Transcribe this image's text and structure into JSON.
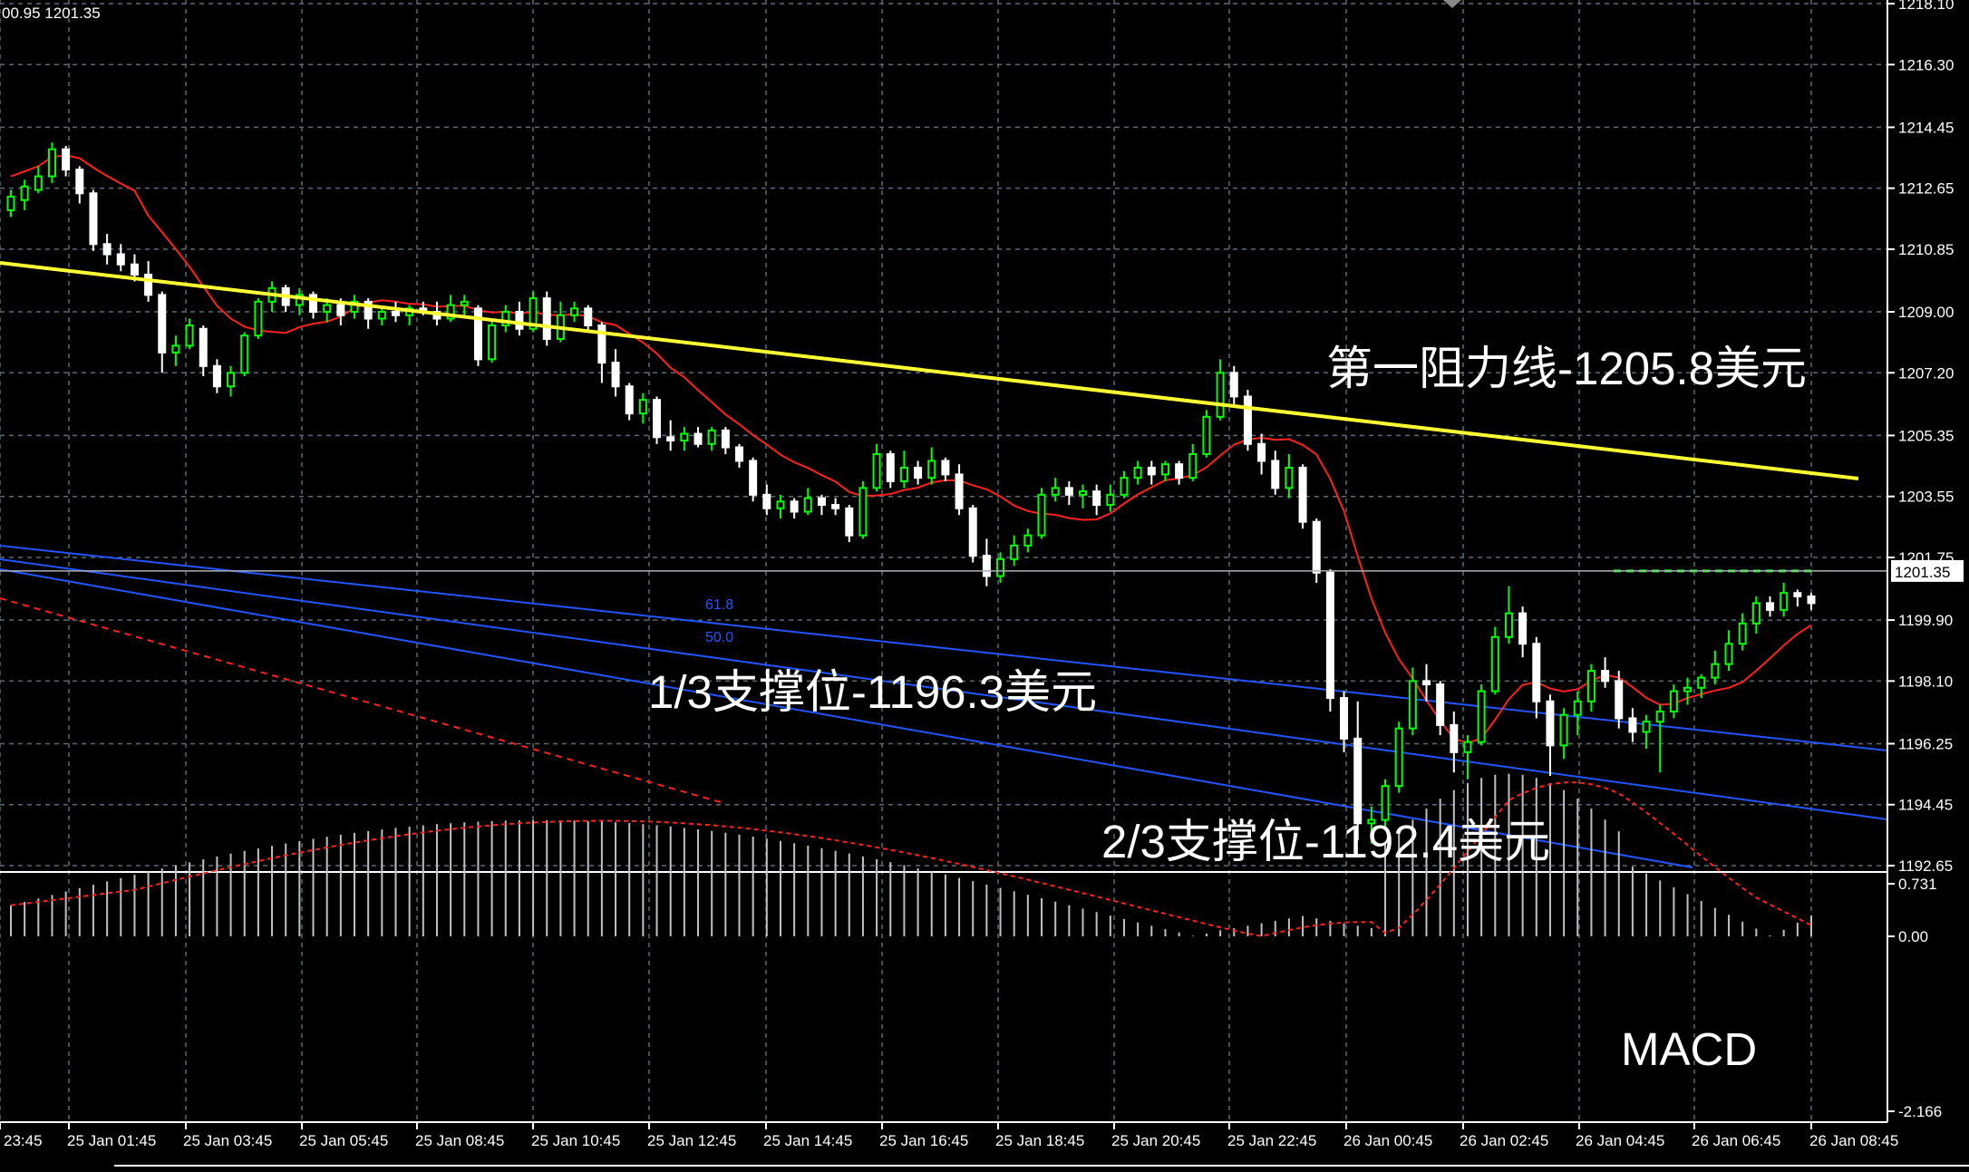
{
  "header": {
    "ohlc_text": "00.95 1201.35"
  },
  "price_axis": {
    "ticks": [
      "1218.10",
      "1216.30",
      "1214.45",
      "1212.65",
      "1210.85",
      "1209.00",
      "1207.20",
      "1205.35",
      "1203.55",
      "1201.75",
      "1199.90",
      "1198.10",
      "1196.25",
      "1194.45",
      "1192.65"
    ],
    "current_price": "1201.35"
  },
  "macd_axis": {
    "ticks": [
      "0.731",
      "0.00",
      "-2.166"
    ]
  },
  "time_axis": {
    "labels": [
      "23:45",
      "25 Jan 01:45",
      "25 Jan 03:45",
      "25 Jan 05:45",
      "25 Jan 08:45",
      "25 Jan 10:45",
      "25 Jan 12:45",
      "25 Jan 14:45",
      "25 Jan 16:45",
      "25 Jan 18:45",
      "25 Jan 20:45",
      "25 Jan 22:45",
      "26 Jan 00:45",
      "26 Jan 02:45",
      "26 Jan 04:45",
      "26 Jan 06:45",
      "26 Jan 08:45"
    ]
  },
  "annotations": {
    "resistance": "第一阻力线-1205.8美元",
    "support_1_3": "1/3支撑位-1196.3美元",
    "support_2_3": "2/3支撑位-1192.4美元",
    "macd_label": "MACD",
    "fib_61_8": "61.8",
    "fib_50_0": "50.0"
  },
  "colors": {
    "background": "#000000",
    "grid": "#5a6a74",
    "bull": "#00ff00",
    "bear": "#ffffff",
    "ma": "#ff2020",
    "trend": "#ffff33",
    "channel": "#2255ff",
    "macd_bar": "#c0c0c0",
    "signal": "#ff2020"
  },
  "chart_data": {
    "type": "candlestick",
    "timeframe": "15min",
    "ylim": [
      1192.65,
      1218.1
    ],
    "candles": [
      [
        1212.0,
        1212.6,
        1211.8,
        1212.4
      ],
      [
        1212.3,
        1212.9,
        1212.0,
        1212.7
      ],
      [
        1212.6,
        1213.3,
        1212.5,
        1213.0
      ],
      [
        1213.0,
        1214.0,
        1212.8,
        1213.8
      ],
      [
        1213.8,
        1213.9,
        1213.0,
        1213.2
      ],
      [
        1213.2,
        1213.3,
        1212.2,
        1212.5
      ],
      [
        1212.5,
        1212.6,
        1210.8,
        1211.0
      ],
      [
        1211.0,
        1211.3,
        1210.4,
        1210.7
      ],
      [
        1210.7,
        1211.0,
        1210.2,
        1210.4
      ],
      [
        1210.4,
        1210.7,
        1209.9,
        1210.1
      ],
      [
        1210.1,
        1210.5,
        1209.3,
        1209.5
      ],
      [
        1209.5,
        1209.6,
        1207.2,
        1207.8
      ],
      [
        1207.8,
        1208.3,
        1207.4,
        1208.0
      ],
      [
        1208.0,
        1208.8,
        1207.9,
        1208.6
      ],
      [
        1208.5,
        1208.6,
        1207.1,
        1207.4
      ],
      [
        1207.4,
        1207.6,
        1206.6,
        1206.8
      ],
      [
        1206.8,
        1207.4,
        1206.5,
        1207.2
      ],
      [
        1207.2,
        1208.4,
        1207.1,
        1208.3
      ],
      [
        1208.3,
        1209.4,
        1208.2,
        1209.3
      ],
      [
        1209.3,
        1209.9,
        1209.0,
        1209.7
      ],
      [
        1209.7,
        1209.8,
        1209.0,
        1209.2
      ],
      [
        1209.2,
        1209.7,
        1208.9,
        1209.5
      ],
      [
        1209.5,
        1209.6,
        1208.8,
        1209.0
      ],
      [
        1209.0,
        1209.4,
        1208.7,
        1209.2
      ],
      [
        1209.2,
        1209.4,
        1208.6,
        1208.9
      ],
      [
        1209.0,
        1209.5,
        1208.8,
        1209.3
      ],
      [
        1209.3,
        1209.4,
        1208.5,
        1208.8
      ],
      [
        1208.8,
        1209.1,
        1208.6,
        1209.0
      ],
      [
        1209.0,
        1209.3,
        1208.7,
        1208.9
      ],
      [
        1208.9,
        1209.2,
        1208.6,
        1209.1
      ],
      [
        1209.1,
        1209.3,
        1208.9,
        1209.0
      ],
      [
        1209.0,
        1209.3,
        1208.6,
        1208.8
      ],
      [
        1208.8,
        1209.5,
        1208.7,
        1209.2
      ],
      [
        1209.2,
        1209.5,
        1208.9,
        1209.3
      ],
      [
        1209.1,
        1209.2,
        1207.4,
        1207.6
      ],
      [
        1207.6,
        1208.8,
        1207.5,
        1208.6
      ],
      [
        1208.6,
        1209.2,
        1208.4,
        1209.0
      ],
      [
        1209.0,
        1209.3,
        1208.3,
        1208.5
      ],
      [
        1208.5,
        1209.6,
        1208.4,
        1209.4
      ],
      [
        1209.4,
        1209.6,
        1208.0,
        1208.2
      ],
      [
        1208.2,
        1209.3,
        1208.1,
        1208.9
      ],
      [
        1208.9,
        1209.3,
        1208.7,
        1209.1
      ],
      [
        1209.1,
        1209.2,
        1208.4,
        1208.6
      ],
      [
        1208.6,
        1208.7,
        1206.9,
        1207.5
      ],
      [
        1207.5,
        1207.9,
        1206.5,
        1206.8
      ],
      [
        1206.8,
        1206.9,
        1205.8,
        1206.0
      ],
      [
        1206.0,
        1206.6,
        1205.7,
        1206.4
      ],
      [
        1206.4,
        1206.5,
        1205.1,
        1205.3
      ],
      [
        1205.3,
        1205.8,
        1204.9,
        1205.2
      ],
      [
        1205.2,
        1205.6,
        1204.9,
        1205.4
      ],
      [
        1205.4,
        1205.6,
        1205.0,
        1205.1
      ],
      [
        1205.1,
        1205.6,
        1204.9,
        1205.5
      ],
      [
        1205.5,
        1205.6,
        1204.8,
        1205.0
      ],
      [
        1205.0,
        1205.1,
        1204.4,
        1204.6
      ],
      [
        1204.6,
        1204.7,
        1203.4,
        1203.6
      ],
      [
        1203.6,
        1203.9,
        1203.0,
        1203.2
      ],
      [
        1203.2,
        1203.6,
        1202.9,
        1203.4
      ],
      [
        1203.4,
        1203.5,
        1202.9,
        1203.1
      ],
      [
        1203.1,
        1203.8,
        1203.0,
        1203.5
      ],
      [
        1203.5,
        1203.6,
        1203.0,
        1203.3
      ],
      [
        1203.3,
        1203.5,
        1203.0,
        1203.2
      ],
      [
        1203.2,
        1203.3,
        1202.2,
        1202.4
      ],
      [
        1202.4,
        1204.0,
        1202.3,
        1203.8
      ],
      [
        1203.8,
        1205.1,
        1203.7,
        1204.8
      ],
      [
        1204.8,
        1204.9,
        1203.8,
        1204.0
      ],
      [
        1204.0,
        1204.9,
        1203.8,
        1204.4
      ],
      [
        1204.4,
        1204.6,
        1203.9,
        1204.1
      ],
      [
        1204.1,
        1205.0,
        1203.9,
        1204.6
      ],
      [
        1204.6,
        1204.7,
        1204.0,
        1204.2
      ],
      [
        1204.2,
        1204.5,
        1203.0,
        1203.2
      ],
      [
        1203.2,
        1203.3,
        1201.6,
        1201.8
      ],
      [
        1201.8,
        1202.3,
        1200.9,
        1201.2
      ],
      [
        1201.2,
        1201.9,
        1201.0,
        1201.7
      ],
      [
        1201.7,
        1202.4,
        1201.5,
        1202.1
      ],
      [
        1202.1,
        1202.6,
        1201.9,
        1202.4
      ],
      [
        1202.4,
        1203.8,
        1202.3,
        1203.6
      ],
      [
        1203.6,
        1204.1,
        1203.4,
        1203.8
      ],
      [
        1203.8,
        1204.0,
        1203.3,
        1203.6
      ],
      [
        1203.6,
        1203.9,
        1203.2,
        1203.7
      ],
      [
        1203.7,
        1203.9,
        1203.0,
        1203.3
      ],
      [
        1203.3,
        1203.9,
        1203.1,
        1203.6
      ],
      [
        1203.6,
        1204.3,
        1203.5,
        1204.1
      ],
      [
        1204.1,
        1204.6,
        1203.9,
        1204.4
      ],
      [
        1204.4,
        1204.6,
        1203.9,
        1204.2
      ],
      [
        1204.2,
        1204.6,
        1204.0,
        1204.5
      ],
      [
        1204.5,
        1204.6,
        1203.9,
        1204.1
      ],
      [
        1204.1,
        1205.1,
        1204.0,
        1204.8
      ],
      [
        1204.8,
        1206.1,
        1204.7,
        1205.9
      ],
      [
        1205.9,
        1207.6,
        1205.8,
        1207.2
      ],
      [
        1207.2,
        1207.4,
        1206.2,
        1206.5
      ],
      [
        1206.5,
        1206.7,
        1204.9,
        1205.1
      ],
      [
        1205.1,
        1205.4,
        1204.2,
        1204.6
      ],
      [
        1204.6,
        1204.9,
        1203.6,
        1203.8
      ],
      [
        1203.8,
        1204.8,
        1203.5,
        1204.4
      ],
      [
        1204.4,
        1204.5,
        1202.6,
        1202.8
      ],
      [
        1202.8,
        1202.9,
        1201.0,
        1201.3
      ],
      [
        1201.3,
        1201.4,
        1197.2,
        1197.6
      ],
      [
        1197.6,
        1197.8,
        1196.0,
        1196.4
      ],
      [
        1196.4,
        1197.5,
        1193.4,
        1193.9
      ],
      [
        1193.9,
        1194.4,
        1193.3,
        1194.0
      ],
      [
        1194.0,
        1195.2,
        1193.8,
        1195.0
      ],
      [
        1195.0,
        1196.9,
        1194.8,
        1196.7
      ],
      [
        1196.7,
        1198.5,
        1196.5,
        1198.1
      ],
      [
        1198.1,
        1198.6,
        1197.5,
        1198.0
      ],
      [
        1198.0,
        1198.1,
        1196.5,
        1196.8
      ],
      [
        1196.8,
        1197.2,
        1195.4,
        1196.0
      ],
      [
        1196.0,
        1196.5,
        1195.2,
        1196.3
      ],
      [
        1196.3,
        1198.0,
        1196.2,
        1197.8
      ],
      [
        1197.8,
        1199.7,
        1197.7,
        1199.4
      ],
      [
        1199.4,
        1200.9,
        1199.2,
        1200.1
      ],
      [
        1200.1,
        1200.3,
        1198.8,
        1199.2
      ],
      [
        1199.2,
        1199.4,
        1197.0,
        1197.5
      ],
      [
        1197.5,
        1197.7,
        1195.3,
        1196.2
      ],
      [
        1196.2,
        1197.3,
        1195.8,
        1197.1
      ],
      [
        1197.1,
        1197.8,
        1196.5,
        1197.5
      ],
      [
        1197.5,
        1198.6,
        1197.2,
        1198.4
      ],
      [
        1198.4,
        1198.8,
        1197.9,
        1198.1
      ],
      [
        1198.1,
        1198.4,
        1196.7,
        1197.0
      ],
      [
        1197.0,
        1197.3,
        1196.3,
        1196.6
      ],
      [
        1196.6,
        1197.1,
        1196.1,
        1196.9
      ],
      [
        1196.9,
        1197.4,
        1195.4,
        1197.2
      ],
      [
        1197.2,
        1198.0,
        1197.0,
        1197.8
      ],
      [
        1197.8,
        1198.2,
        1197.4,
        1197.9
      ],
      [
        1197.9,
        1198.3,
        1197.6,
        1198.2
      ],
      [
        1198.2,
        1199.0,
        1198.0,
        1198.6
      ],
      [
        1198.6,
        1199.6,
        1198.4,
        1199.2
      ],
      [
        1199.2,
        1200.1,
        1199.0,
        1199.8
      ],
      [
        1199.8,
        1200.6,
        1199.5,
        1200.4
      ],
      [
        1200.4,
        1200.6,
        1200.0,
        1200.2
      ],
      [
        1200.2,
        1201.0,
        1200.0,
        1200.7
      ],
      [
        1200.7,
        1200.8,
        1200.3,
        1200.6
      ],
      [
        1200.6,
        1200.7,
        1200.2,
        1200.4
      ]
    ]
  }
}
